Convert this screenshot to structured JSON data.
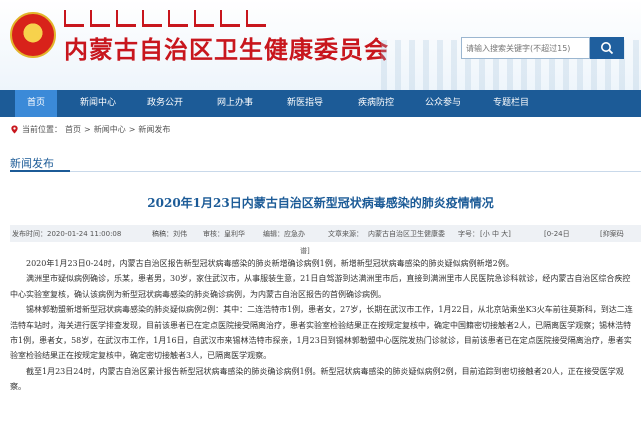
{
  "header": {
    "site_title": "内蒙古自治区卫生健康委员会",
    "search_placeholder": "请输入搜索关键字(不超过15)"
  },
  "nav": {
    "items": [
      {
        "label": "首页",
        "active": true
      },
      {
        "label": "新闻中心"
      },
      {
        "label": "政务公开"
      },
      {
        "label": "网上办事"
      },
      {
        "label": "新医指导"
      },
      {
        "label": "疾病防控"
      },
      {
        "label": "公众参与"
      },
      {
        "label": "专题栏目"
      }
    ]
  },
  "breadcrumb": {
    "prefix": "当前位置：",
    "items": [
      "首页",
      "新闻中心",
      "新闻发布"
    ],
    "separator": ">"
  },
  "section": {
    "title": "新闻发布"
  },
  "article": {
    "title": "2020年1月23日内蒙古自治区新型冠状病毒感染的肺炎疫情情况",
    "meta": {
      "date": "发布时间：2020-01-24 11:00:08",
      "draft": "稿稿：刘伟",
      "review": "审核：皇利华",
      "edit": "编辑：应急办",
      "source": "文章来源：",
      "source_value": "内蒙古自治区卫生健康委",
      "font": "字号：",
      "font_options": "[小 中 大]",
      "date2": "[0-24日",
      "print": "[抑案码",
      "tail": "谱]"
    },
    "paragraphs": [
      "2020年1月23日0-24时，内蒙古自治区报告新型冠状病毒感染的肺炎新增确诊病例1例，新增新型冠状病毒感染的肺炎疑似病例新增2例。",
      "满洲里市疑似病例确诊，乐某，患者男，30岁，家住武汉市，从事服装生意，21日自驾游到达满洲里市后，直接到满洲里市人民医院急诊科就诊，经内蒙古自治区综合疾控中心实验室复核，确认该病例为新型冠状病毒感染的肺炎确诊病例，为内蒙古自治区报告的首例确诊病例。",
      "锡林郭勒盟新增新型冠状病毒感染的肺炎疑似病例2例：其中：二连浩特市1例，患者女，27岁，长期在武汉市工作，1月22日，从北京站乘坐K3火车前往莫斯科，到达二连浩特车站时，海关进行医学排查发现，目前该患者已在定点医院接受隔离治疗，患者实验室检验结果正在按规定复核中，确定中国籍密切接触者2人，已隔离医学观察；锡林浩特市1例，患者女，58岁，在武汉市工作，1月16日，自武汉市来锡林浩特市探亲，1月23日到锡林郭勒盟中心医院发热门诊就诊，目前该患者已在定点医院接受隔离治疗，患者实验室检验结果正在按规定复核中，确定密切接触者3人，已隔离医学观察。",
      "截至1月23日24时，内蒙古自治区累计报告新型冠状病毒感染的肺炎确诊病例1例。新型冠状病毒感染的肺炎疑似病例2例，目前追踪到密切接触者20人，正在接受医学观察。"
    ]
  }
}
